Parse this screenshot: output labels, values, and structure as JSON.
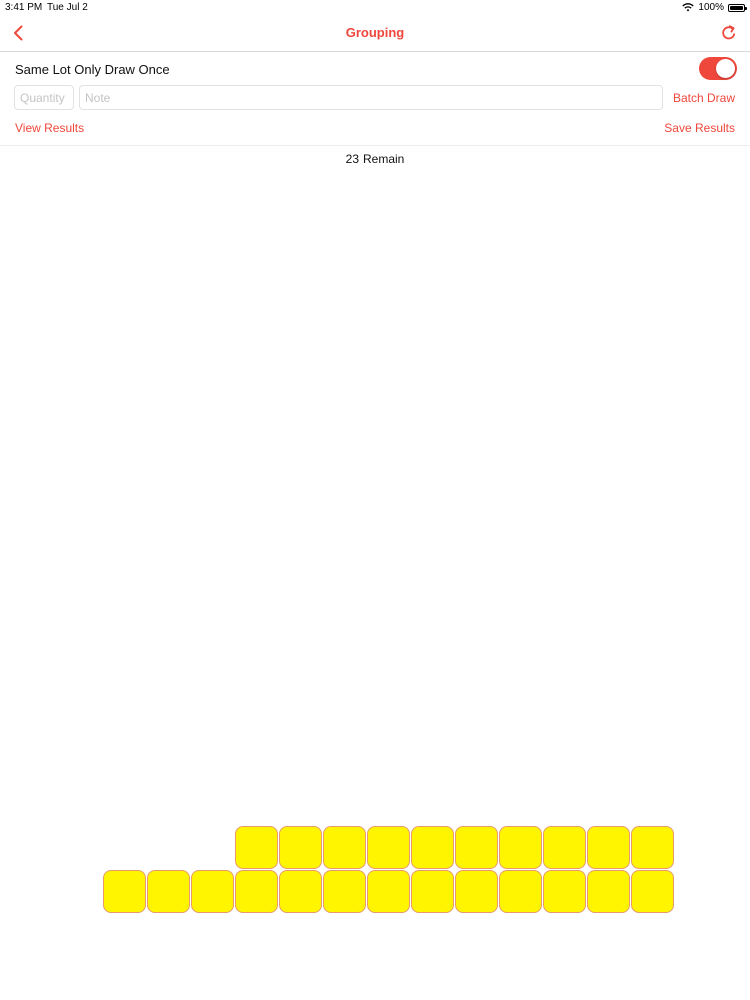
{
  "status_bar": {
    "time": "3:41 PM",
    "date": "Tue Jul 2",
    "battery": "100%"
  },
  "nav": {
    "title": "Grouping",
    "back_icon": "chevron-left-icon",
    "refresh_icon": "refresh-icon"
  },
  "options": {
    "same_lot_label": "Same Lot Only Draw Once",
    "same_lot_enabled": true
  },
  "inputs": {
    "quantity_placeholder": "Quantity",
    "quantity_value": "",
    "note_placeholder": "Note",
    "note_value": ""
  },
  "actions": {
    "batch_draw": "Batch Draw",
    "view_results": "View Results",
    "save_results": "Save Results"
  },
  "remain": {
    "count": "23",
    "label": "Remain"
  },
  "lots": {
    "rows": [
      10,
      13
    ],
    "tile_color": "#fff500"
  },
  "colors": {
    "accent": "#f0473c",
    "tile_border": "#e89a6c"
  }
}
